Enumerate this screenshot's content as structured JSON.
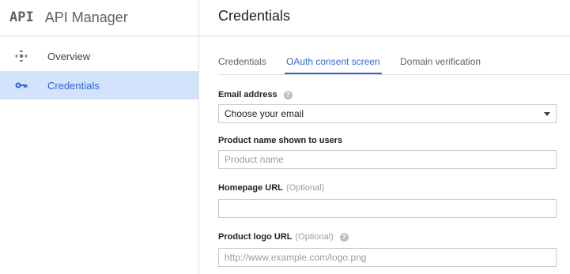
{
  "app": {
    "logo_text": "API",
    "title": "API Manager"
  },
  "sidebar": {
    "items": [
      {
        "label": "Overview",
        "icon": "overview-icon",
        "active": false
      },
      {
        "label": "Credentials",
        "icon": "key-icon",
        "active": true
      }
    ]
  },
  "main": {
    "title": "Credentials",
    "tabs": [
      {
        "label": "Credentials",
        "active": false
      },
      {
        "label": "OAuth consent screen",
        "active": true
      },
      {
        "label": "Domain verification",
        "active": false
      }
    ]
  },
  "form": {
    "email": {
      "label": "Email address",
      "selected_value": "Choose your email"
    },
    "product_name": {
      "label": "Product name shown to users",
      "placeholder": "Product name",
      "value": ""
    },
    "homepage": {
      "label": "Homepage URL",
      "optional": "(Optional)",
      "placeholder": "",
      "value": ""
    },
    "logo": {
      "label": "Product logo URL",
      "optional": "(Optional)",
      "placeholder": "http://www.example.com/logo.png",
      "value": ""
    }
  },
  "colors": {
    "accent": "#3367d6",
    "active_bg": "#d2e3fb"
  }
}
